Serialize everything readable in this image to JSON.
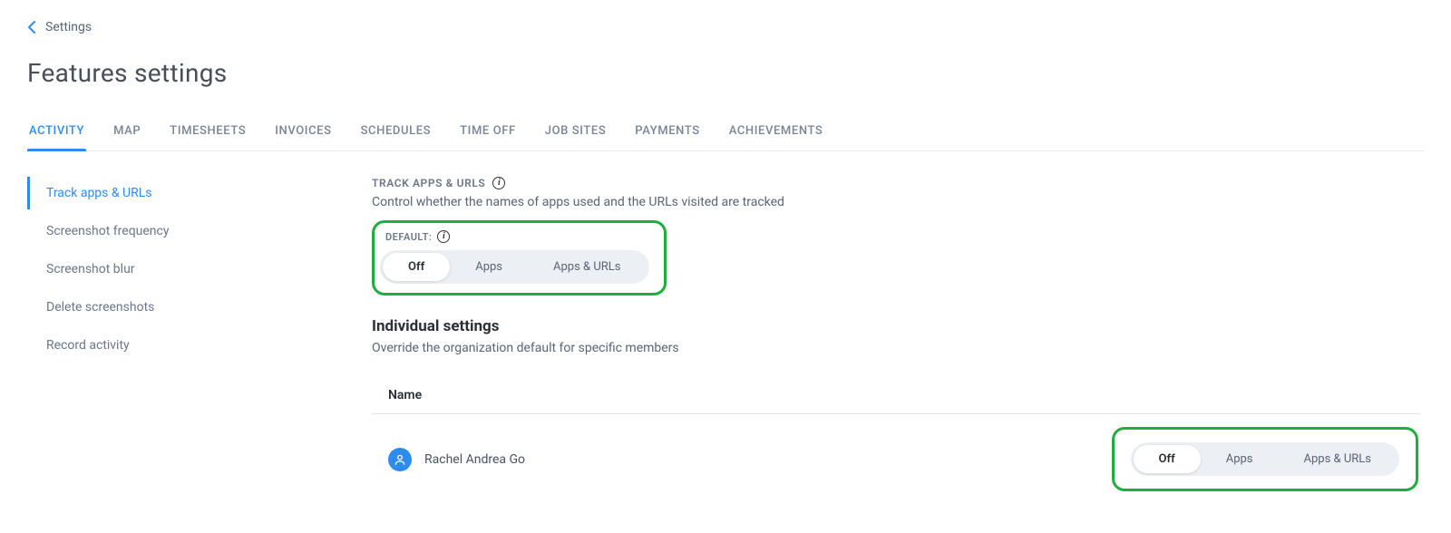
{
  "breadcrumb": {
    "label": "Settings"
  },
  "page_title": "Features settings",
  "tabs": [
    {
      "label": "ACTIVITY",
      "active": true
    },
    {
      "label": "MAP"
    },
    {
      "label": "TIMESHEETS"
    },
    {
      "label": "INVOICES"
    },
    {
      "label": "SCHEDULES"
    },
    {
      "label": "TIME OFF"
    },
    {
      "label": "JOB SITES"
    },
    {
      "label": "PAYMENTS"
    },
    {
      "label": "ACHIEVEMENTS"
    }
  ],
  "sidebar": {
    "items": [
      {
        "label": "Track apps & URLs",
        "active": true
      },
      {
        "label": "Screenshot frequency"
      },
      {
        "label": "Screenshot blur"
      },
      {
        "label": "Delete screenshots"
      },
      {
        "label": "Record activity"
      }
    ]
  },
  "section": {
    "heading": "TRACK APPS & URLS",
    "description": "Control whether the names of apps used and the URLs visited are tracked",
    "default_label": "DEFAULT:"
  },
  "segmented_options": {
    "off": "Off",
    "apps": "Apps",
    "apps_urls": "Apps & URLs"
  },
  "default_selection": "off",
  "individual": {
    "title": "Individual settings",
    "description": "Override the organization default for specific members",
    "column_name": "Name"
  },
  "members": [
    {
      "name": "Rachel Andrea Go",
      "selection": "off"
    }
  ],
  "colors": {
    "accent": "#2e8cf0",
    "highlight_border": "#1fae3e",
    "text_muted": "#6b7688"
  }
}
